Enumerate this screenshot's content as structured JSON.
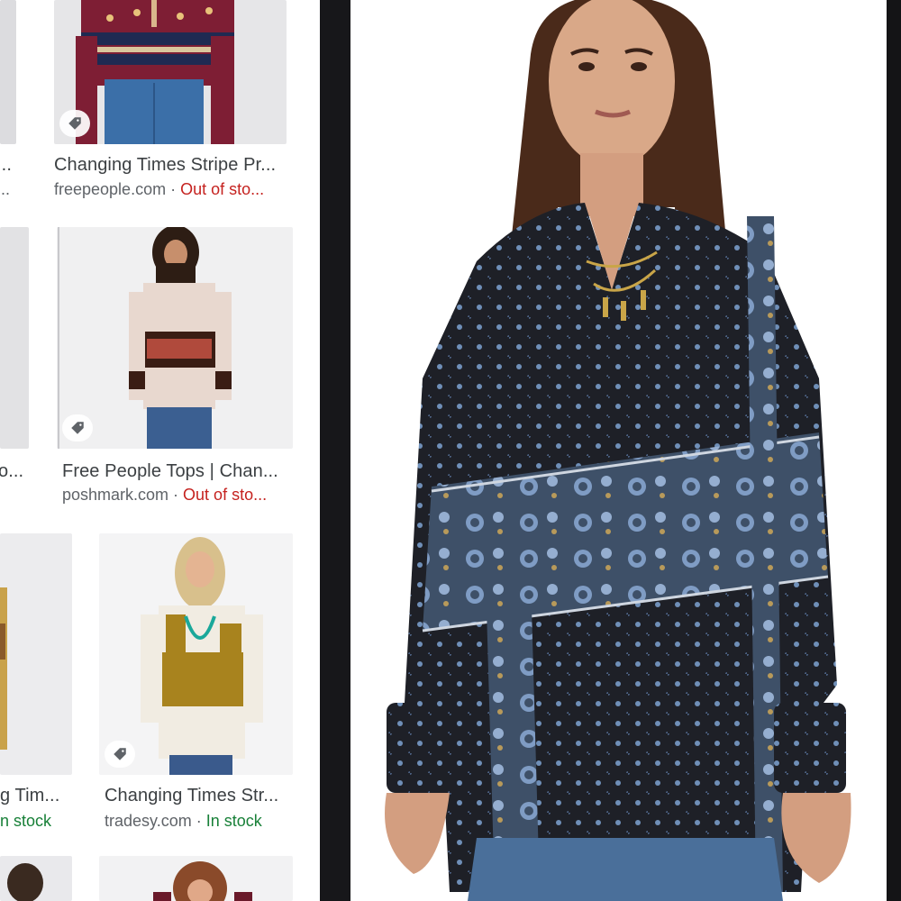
{
  "results": [
    {
      "title": "Changing Times Stripe Pr...",
      "source": "freepeople.com",
      "separator": " · ",
      "stock": "Out of sto...",
      "stock_status": "out",
      "tag_icon": "tag-icon"
    },
    {
      "title": "Free People Tops | Chan...",
      "source": "poshmark.com",
      "separator": " · ",
      "stock": "Out of sto...",
      "stock_status": "out",
      "tag_icon": "tag-icon"
    },
    {
      "title": "Changing Times Str...",
      "source": "tradesy.com",
      "separator": " · ",
      "stock": "In stock",
      "stock_status": "in",
      "tag_icon": "tag-icon"
    },
    {
      "title": "...",
      "source": "...",
      "separator": "",
      "stock": "",
      "stock_status": "out"
    },
    {
      "title": "o...",
      "source": "",
      "separator": "",
      "stock": "",
      "stock_status": "out"
    },
    {
      "title": "g Tim...",
      "source": "",
      "separator": "",
      "stock": "n stock",
      "stock_status": "in"
    }
  ],
  "colors": {
    "stock_out": "#c5221f",
    "stock_in": "#188038",
    "title_text": "#3c4043",
    "meta_text": "#5f6368",
    "dark_divider": "#17171a"
  }
}
